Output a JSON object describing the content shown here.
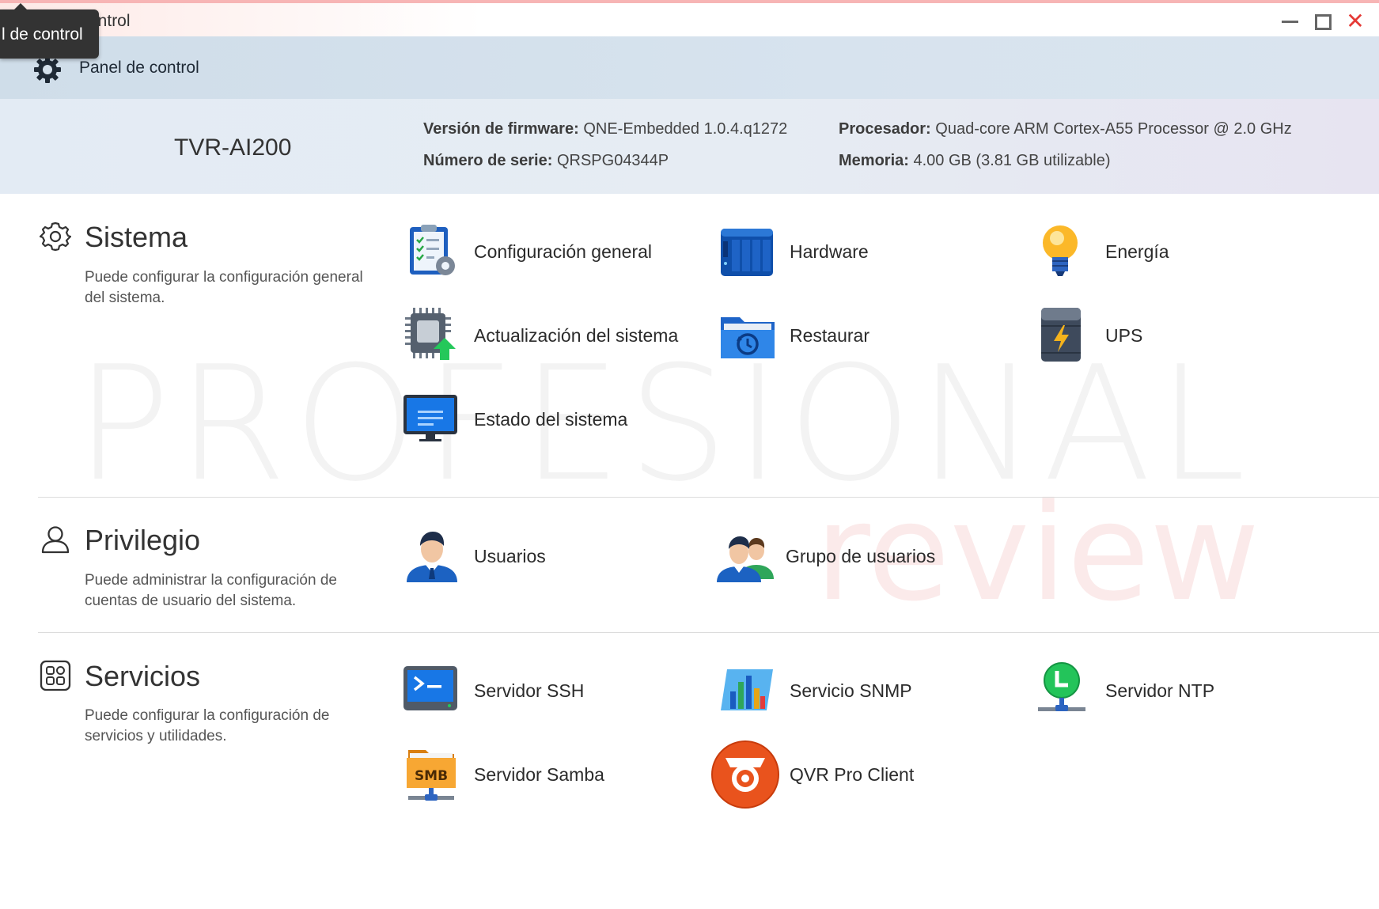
{
  "window": {
    "title": "ontrol",
    "tooltip": "l de control",
    "minimize_icon": "minimize-icon",
    "maximize_icon": "maximize-icon",
    "close_glyph": "✕"
  },
  "header": {
    "title": "Panel de control",
    "icon": "gear-icon"
  },
  "device": {
    "name": "TVR-AI200",
    "firmware_label": "Versión de firmware:",
    "firmware_value": "QNE-Embedded 1.0.4.q1272",
    "serial_label": "Número de serie:",
    "serial_value": "QRSPG04344P",
    "cpu_label": "Procesador:",
    "cpu_value": "Quad-core ARM Cortex-A55 Processor @ 2.0 GHz",
    "memory_label": "Memoria:",
    "memory_value": "4.00 GB (3.81 GB utilizable)"
  },
  "watermark": {
    "line1": "PROFESIONAL",
    "line2": "review"
  },
  "sections": {
    "sistema": {
      "title": "Sistema",
      "desc": "Puede configurar la configuración general del sistema.",
      "icon": "settings-icon",
      "items": [
        {
          "label": "Configuración general",
          "icon": "clipboard-settings-icon"
        },
        {
          "label": "Hardware",
          "icon": "hardware-icon"
        },
        {
          "label": "Energía",
          "icon": "lightbulb-icon"
        },
        {
          "label": "Actualización del sistema",
          "icon": "chip-update-icon"
        },
        {
          "label": "Restaurar",
          "icon": "restore-folder-icon"
        },
        {
          "label": "UPS",
          "icon": "ups-icon"
        },
        {
          "label": "Estado del sistema",
          "icon": "monitor-icon"
        }
      ]
    },
    "privilegio": {
      "title": "Privilegio",
      "desc": "Puede administrar la configuración de cuentas de usuario del sistema.",
      "icon": "user-icon",
      "items": [
        {
          "label": "Usuarios",
          "icon": "user-avatar-icon"
        },
        {
          "label": "Grupo de usuarios",
          "icon": "user-group-icon"
        }
      ]
    },
    "servicios": {
      "title": "Servicios",
      "desc": "Puede configurar la configuración de servicios y utilidades.",
      "icon": "apps-grid-icon",
      "items": [
        {
          "label": "Servidor SSH",
          "icon": "terminal-icon"
        },
        {
          "label": "Servicio SNMP",
          "icon": "snmp-chart-icon"
        },
        {
          "label": "Servidor NTP",
          "icon": "ntp-clock-icon"
        },
        {
          "label": "Servidor Samba",
          "icon": "smb-folder-icon",
          "icon_text": "SMB"
        },
        {
          "label": "QVR Pro Client",
          "icon": "camera-icon"
        }
      ]
    }
  }
}
